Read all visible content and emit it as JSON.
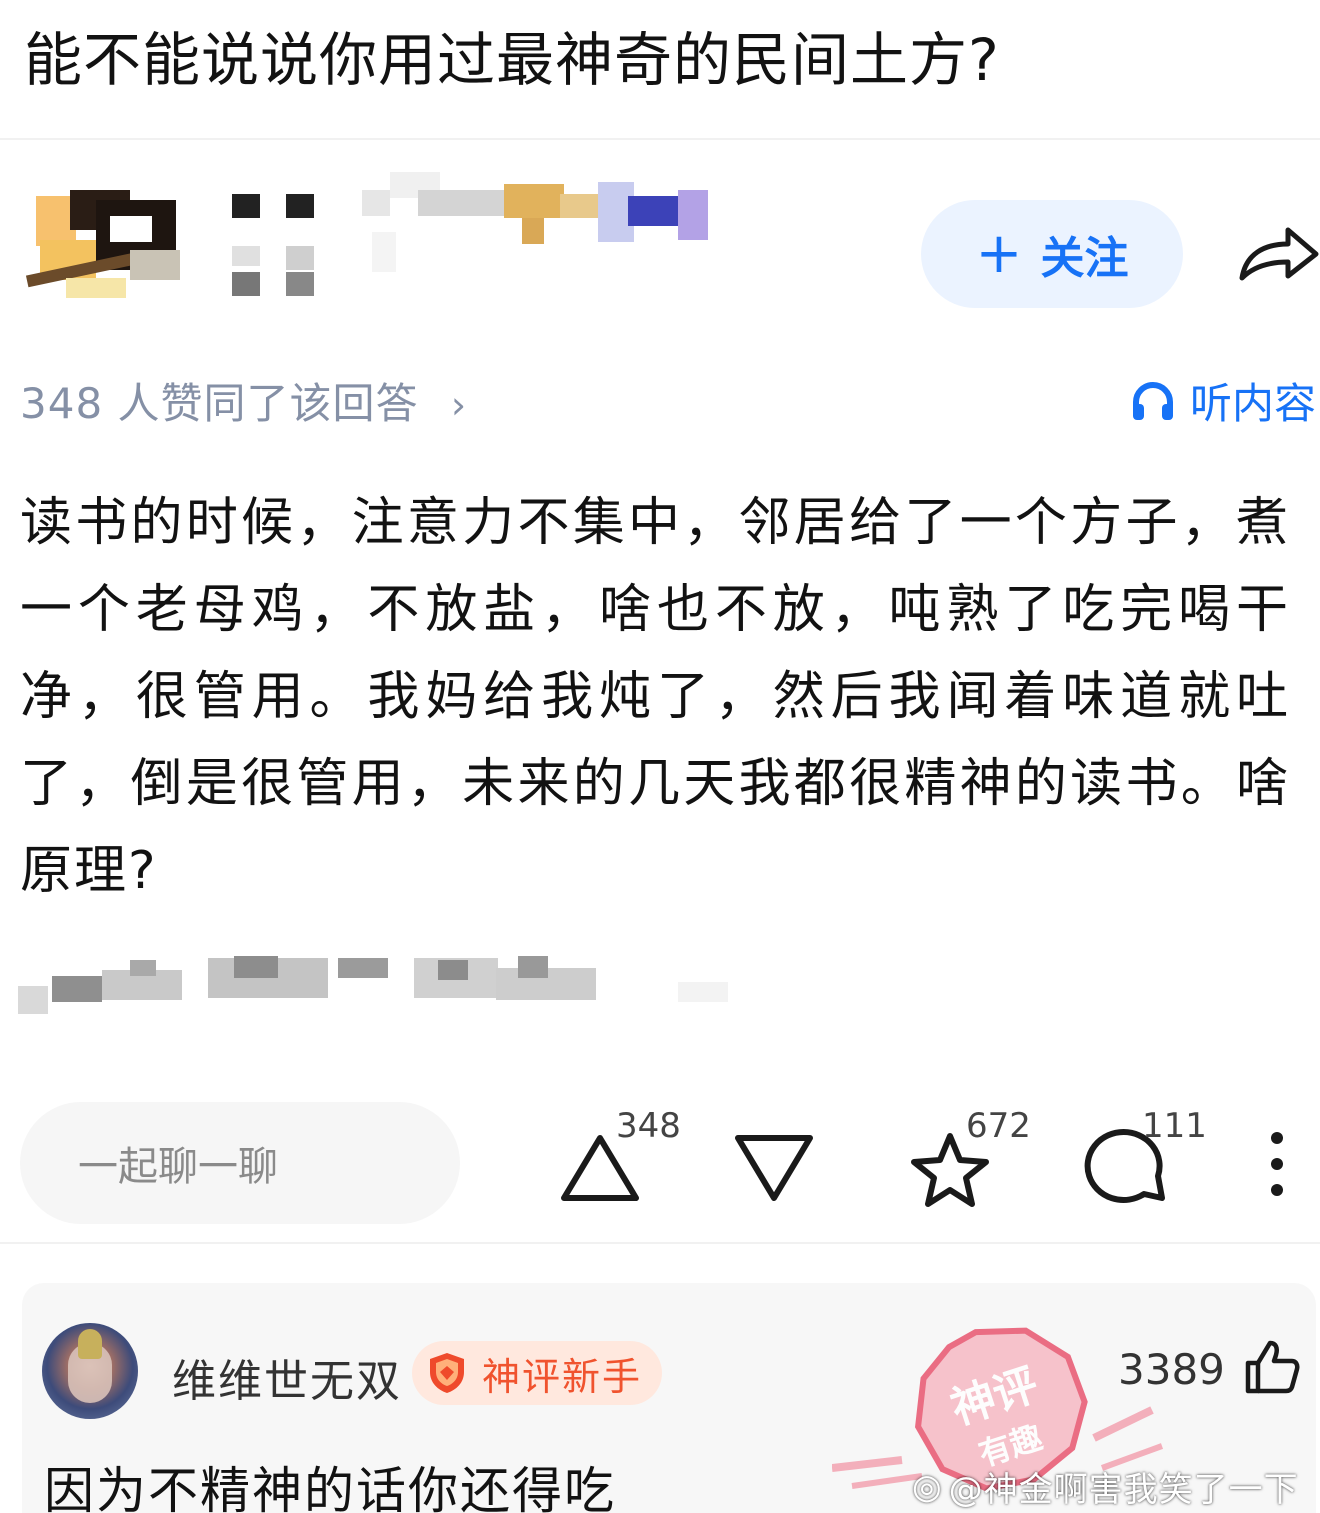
{
  "question": {
    "title": "能不能说说你用过最神奇的民间土方?"
  },
  "author": {
    "follow_label": "关注",
    "follow_plus": "+"
  },
  "meta": {
    "upvote_summary": "348 人赞同了该回答",
    "upvote_chevron": "›",
    "listen_label": "听内容"
  },
  "answer": {
    "body": "读书的时候，注意力不集中，邻居给了一个方子，煮一个老母鸡，不放盐，啥也不放，吨熟了吃完喝干净，很管用。我妈给我炖了，然后我闻着味道就吐了，倒是很管用，未来的几天我都很精神的读书。啥原理?"
  },
  "actions": {
    "comment_placeholder": "一起聊一聊",
    "upvote_count": "348",
    "favorite_count": "672",
    "comment_count": "111",
    "icons": [
      "upvote-icon",
      "downvote-icon",
      "star-icon",
      "comment-icon",
      "more-icon"
    ]
  },
  "hot_comment": {
    "username": "维维世无双",
    "badge": "神评新手",
    "like_count": "3389",
    "text": "因为不精神的话你还得吃",
    "stamp_text_top": "神评",
    "stamp_text_bottom": "有趣"
  },
  "watermark": {
    "text": "@神金啊害我笑了一下"
  },
  "colors": {
    "accent": "#1772f6",
    "follow_bg": "#ebf3ff",
    "badge_bg": "#ffe8de",
    "badge_fg": "#f0532e",
    "muted": "#8590a6"
  }
}
